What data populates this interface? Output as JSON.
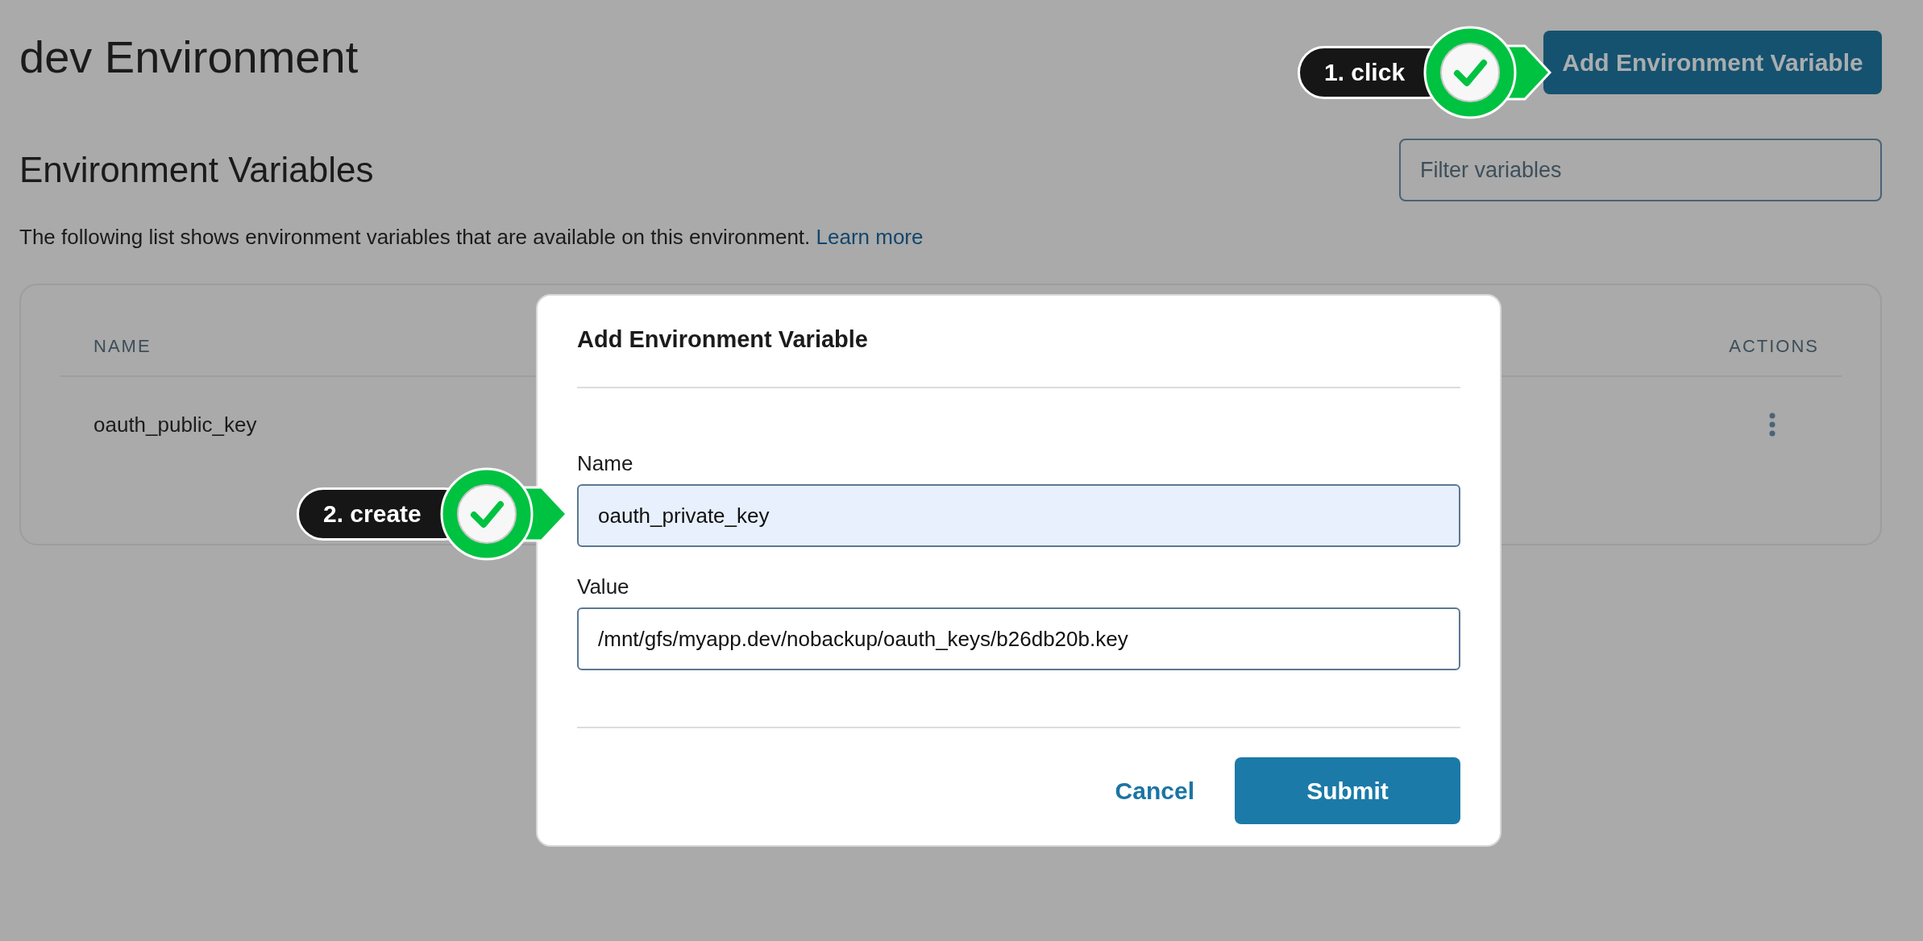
{
  "page": {
    "title": "dev Environment",
    "add_button": "Add Environment Variable"
  },
  "section": {
    "heading": "Environment Variables",
    "filter": {
      "placeholder": "Filter variables"
    },
    "description": "The following list shows environment variables that are available on this environment.",
    "link": "Learn more"
  },
  "table": {
    "columns": [
      "NAME",
      "ACTIONS"
    ],
    "rows": [
      {
        "name": "oauth_public_key"
      }
    ]
  },
  "modal": {
    "title": "Add Environment Variable",
    "fields": [
      {
        "label": "Name",
        "value": "oauth_private_key",
        "focused": true
      },
      {
        "label": "Value",
        "value": "/mnt/gfs/myapp.dev/nobackup/oauth_keys/b26db20b.key",
        "focused": false
      }
    ],
    "cancel": "Cancel",
    "submit": "Submit"
  },
  "callouts": [
    {
      "label": "1. click"
    },
    {
      "label": "2. create"
    }
  ]
}
